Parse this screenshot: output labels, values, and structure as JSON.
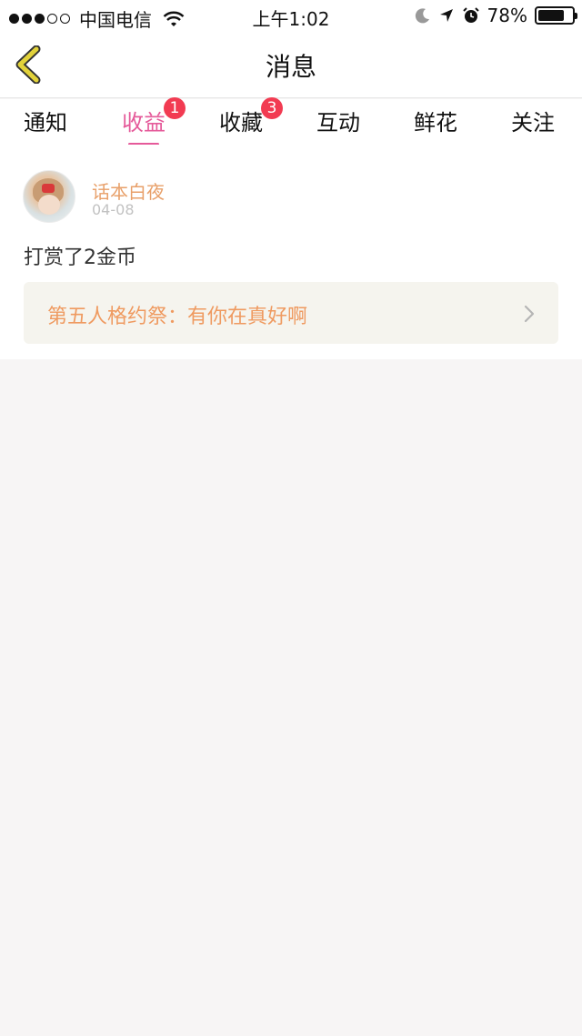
{
  "status_bar": {
    "carrier": "中国电信",
    "time": "上午1:02",
    "battery": "78%",
    "battery_level": 0.78
  },
  "header": {
    "title": "消息"
  },
  "tabs": [
    {
      "label": "通知",
      "badge": ""
    },
    {
      "label": "收益",
      "badge": "1",
      "active": true
    },
    {
      "label": "收藏",
      "badge": "3"
    },
    {
      "label": "互动",
      "badge": ""
    },
    {
      "label": "鲜花",
      "badge": ""
    },
    {
      "label": "关注",
      "badge": ""
    }
  ],
  "message": {
    "username": "话本白夜",
    "date": "04-08",
    "text": "打赏了2金币",
    "link": "第五人格约祭：有你在真好啊"
  },
  "colors": {
    "accent": "#e55a9a",
    "badge": "#f23b52",
    "username": "#e8a06a",
    "link": "#ef9a60",
    "back_icon": "#e2d23a"
  }
}
